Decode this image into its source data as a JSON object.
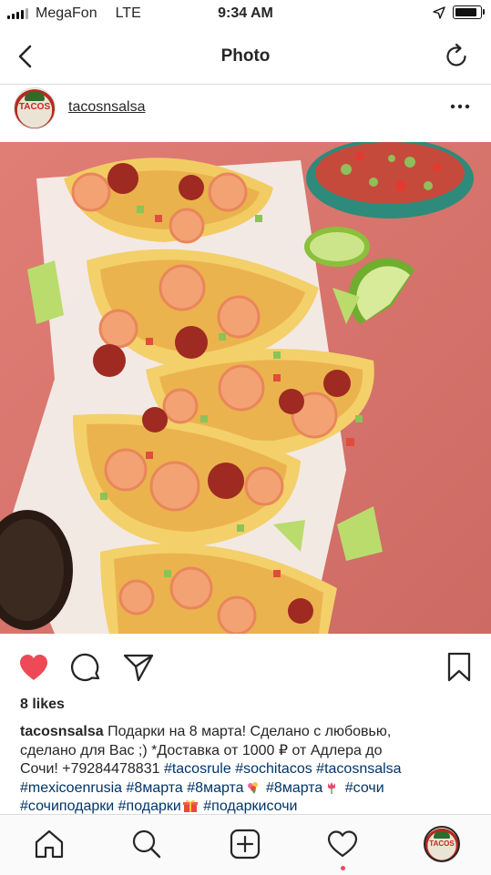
{
  "status_bar": {
    "carrier": "MegaFon",
    "network": "LTE",
    "time": "9:34 AM",
    "battery_level": 0.95,
    "icons": [
      "signal-icon",
      "location-arrow-icon",
      "battery-icon"
    ]
  },
  "nav": {
    "title": "Photo",
    "back_icon": "chevron-left-icon",
    "refresh_icon": "refresh-icon"
  },
  "post": {
    "username": "tacosnsalsa",
    "avatar_text": "TACOS",
    "more_icon": "ellipsis-icon",
    "likes": "8 likes",
    "liked": true,
    "caption": {
      "username": "tacosnsalsa",
      "line1": "Подарки на 8 марта! Сделано с любовью,",
      "line2": "сделано для Вас ;) *Доставка от 1000 ₽ от Адлера до",
      "line3_text": "Сочи! +79284478831 ",
      "line3_tags": [
        "#tacosrule",
        "#sochitacos",
        "#tacosnsalsa"
      ],
      "line4_tags": [
        "#mexicoenrusia",
        "#8марта",
        "#8марта",
        "#8марта",
        "#сочи"
      ],
      "line5_tags": [
        "#сочиподарки",
        "#подарки",
        "#подаркисочи"
      ],
      "emojis": [
        "bouquet-emoji",
        "tulip-emoji",
        "gift-emoji"
      ]
    }
  },
  "actions": {
    "like_icon": "heart-icon",
    "comment_icon": "comment-icon",
    "share_icon": "paper-plane-icon",
    "save_icon": "bookmark-icon"
  },
  "tab_bar": {
    "items": [
      "home-icon",
      "search-icon",
      "add-icon",
      "activity-heart-icon",
      "profile-avatar"
    ],
    "profile_avatar_text": "TACOS"
  },
  "colors": {
    "like_red": "#ed4956",
    "hashtag_blue": "#003569",
    "text": "#262626",
    "photo_background": "#d8736d"
  }
}
